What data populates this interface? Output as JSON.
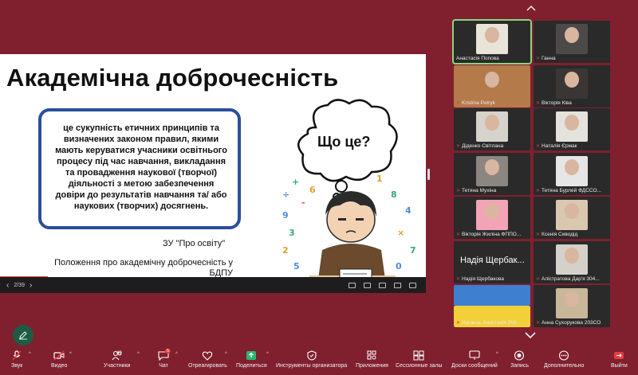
{
  "slide": {
    "title": "Академічна доброчесність",
    "definition": "це сукупність етичних принципів та визначених законом правил, якими мають керуватися учасники освітнього процесу під час навчання, викладання та провадження наукової (творчої) діяльності з метою забезпечення довіри до результатів навчання та/ або наукових (творчих) досягнень.",
    "law": "ЗУ \"Про освіту\"",
    "regulation": "Положення про академічну доброчесність у БДПУ",
    "cloud_text": "Що це?",
    "page": "2/39"
  },
  "participants": [
    {
      "name": "Анастасія Попова",
      "muted": false,
      "active": true
    },
    {
      "name": "Ганна",
      "muted": true
    },
    {
      "name": "Kristina Petryk",
      "muted": true
    },
    {
      "name": "Вікторія Ківа",
      "muted": true
    },
    {
      "name": "Діденко Світлана",
      "muted": true
    },
    {
      "name": "Наталія Єрмак",
      "muted": true
    },
    {
      "name": "Тетяна Мухіна",
      "muted": true
    },
    {
      "name": "Тетяна Бурлей ФДССО...",
      "muted": true
    },
    {
      "name": "Вікторія Жиліна ФППО...",
      "muted": true
    },
    {
      "name": "Ксенія Сиводід",
      "muted": true
    },
    {
      "name": "Надія Щербакова",
      "muted": true,
      "big_name": "Надія Щербак..."
    },
    {
      "name": "Алістратова Дар'я 304...",
      "muted": true
    },
    {
      "name": "Нагаєць Анастасія 203...",
      "muted": true
    },
    {
      "name": "Анна Сухорукова 203СО",
      "muted": true
    }
  ],
  "toolbar": {
    "audio": "Звук",
    "video": "Видео",
    "participants": "Участники",
    "participants_count": "40",
    "chat": "Чат",
    "chat_badge": "5",
    "react": "Отреагировать",
    "share": "Поделиться",
    "host_tools": "Инструменты организатора",
    "apps": "Приложения",
    "breakout": "Сессионные залы",
    "whiteboards": "Доски сообщений",
    "record": "Запись",
    "more": "Дополнительно",
    "leave": "Выйти"
  },
  "colors": {
    "background": "#801f2e",
    "box_border": "#2a4f9b",
    "share_green": "#2bb673",
    "mic_muted": "#e23a3a"
  }
}
